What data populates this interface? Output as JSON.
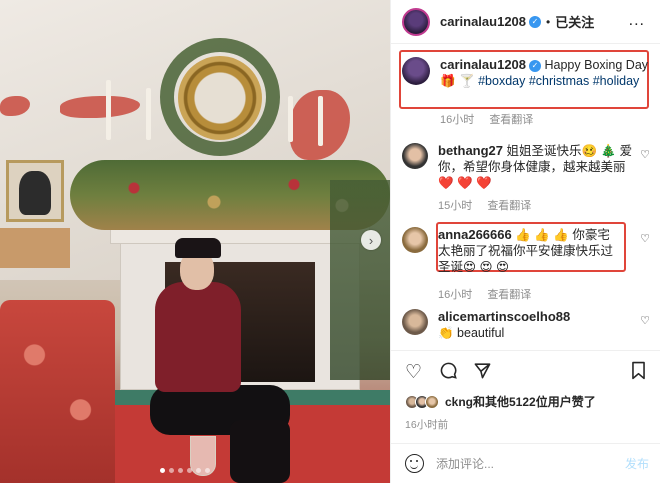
{
  "header": {
    "username": "carinalau1208",
    "separator": "•",
    "follow_state": "已关注",
    "more": "..."
  },
  "caption": {
    "username": "carinalau1208",
    "text": "Happy Boxing Day 🎁 🍸",
    "hashtags": "#boxday #christmas #holiday",
    "time": "16小时",
    "translate": "查看翻译"
  },
  "comments": [
    {
      "username": "bethang27",
      "text": "姐姐圣诞快乐🥴 🎄 爱你，希望你身体健康，越来越美丽❤️ ❤️ ❤️",
      "time": "15小时",
      "translate": "查看翻译"
    },
    {
      "username": "anna266666",
      "text": "👍 👍 👍 你豪宅太艳丽了祝福你平安健康快乐过圣诞😍 😍 😍",
      "time": "16小时",
      "translate": "查看翻译"
    },
    {
      "username": "alicemartinscoelho88",
      "text": "👏 beautiful"
    }
  ],
  "likes": {
    "text": "ckng和其他5122位用户赞了"
  },
  "post_time": "16小时前",
  "comment_box": {
    "placeholder": "添加评论...",
    "post_label": "发布"
  },
  "icons": [
    "heart-icon",
    "comment-icon",
    "share-icon",
    "bookmark-icon",
    "emoji-icon",
    "chevron-right-icon"
  ],
  "colors": {
    "highlight": "#e0453a",
    "hashtag": "#00376b",
    "verified": "#3897f0",
    "post_disabled": "#b2dffc"
  },
  "carousel": {
    "slides": 6,
    "active": 1
  }
}
